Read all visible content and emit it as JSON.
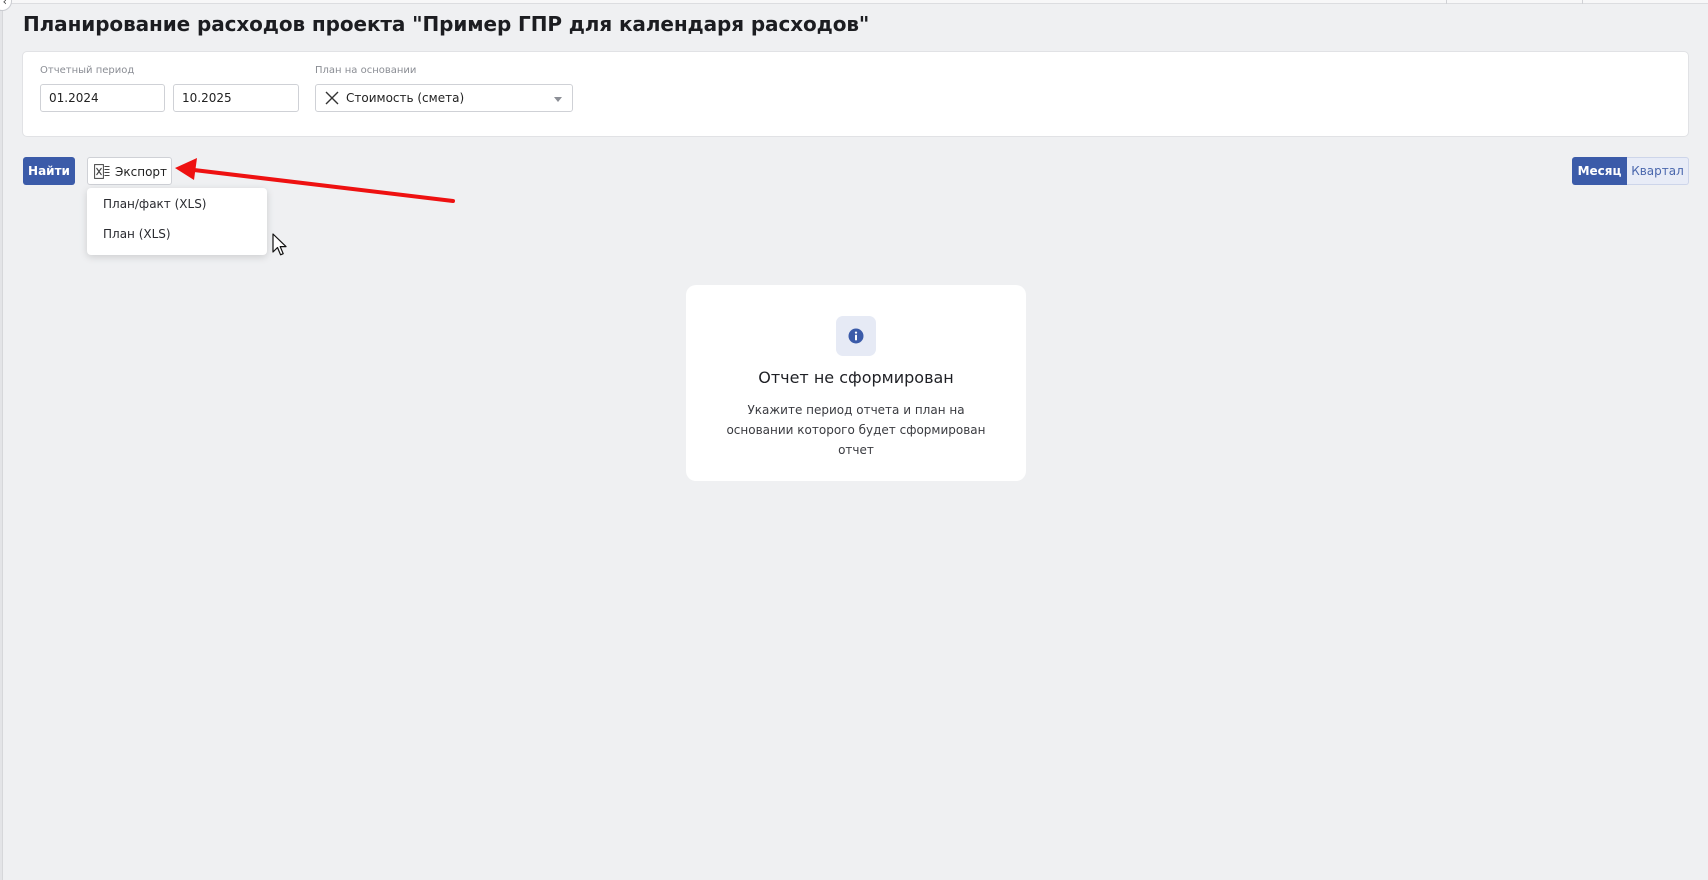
{
  "page": {
    "title": "Планирование расходов проекта \"Пример ГПР для календаря расходов\""
  },
  "filters": {
    "period_label": "Отчетный период",
    "period_from": "01.2024",
    "period_to": "10.2025",
    "plan_label": "План на основании",
    "plan_value": "Стоимость (смета)"
  },
  "actions": {
    "find_label": "Найти",
    "export_label": "Экспорт",
    "export_menu": [
      "План/факт (XLS)",
      "План (XLS)"
    ]
  },
  "view_toggle": {
    "month_label": "Месяц",
    "quarter_label": "Квартал",
    "selected": "Месяц"
  },
  "empty_state": {
    "title": "Отчет не сформирован",
    "description": "Укажите период отчета и план на основании которого будет сформирован отчет"
  },
  "colors": {
    "accent": "#3b5ba9",
    "annotation_arrow": "#ee1111",
    "background": "#eff0f2"
  },
  "icons": [
    "chevron-left-icon",
    "close-icon",
    "chevron-down-icon",
    "excel-icon",
    "info-icon",
    "mouse-cursor-icon"
  ]
}
